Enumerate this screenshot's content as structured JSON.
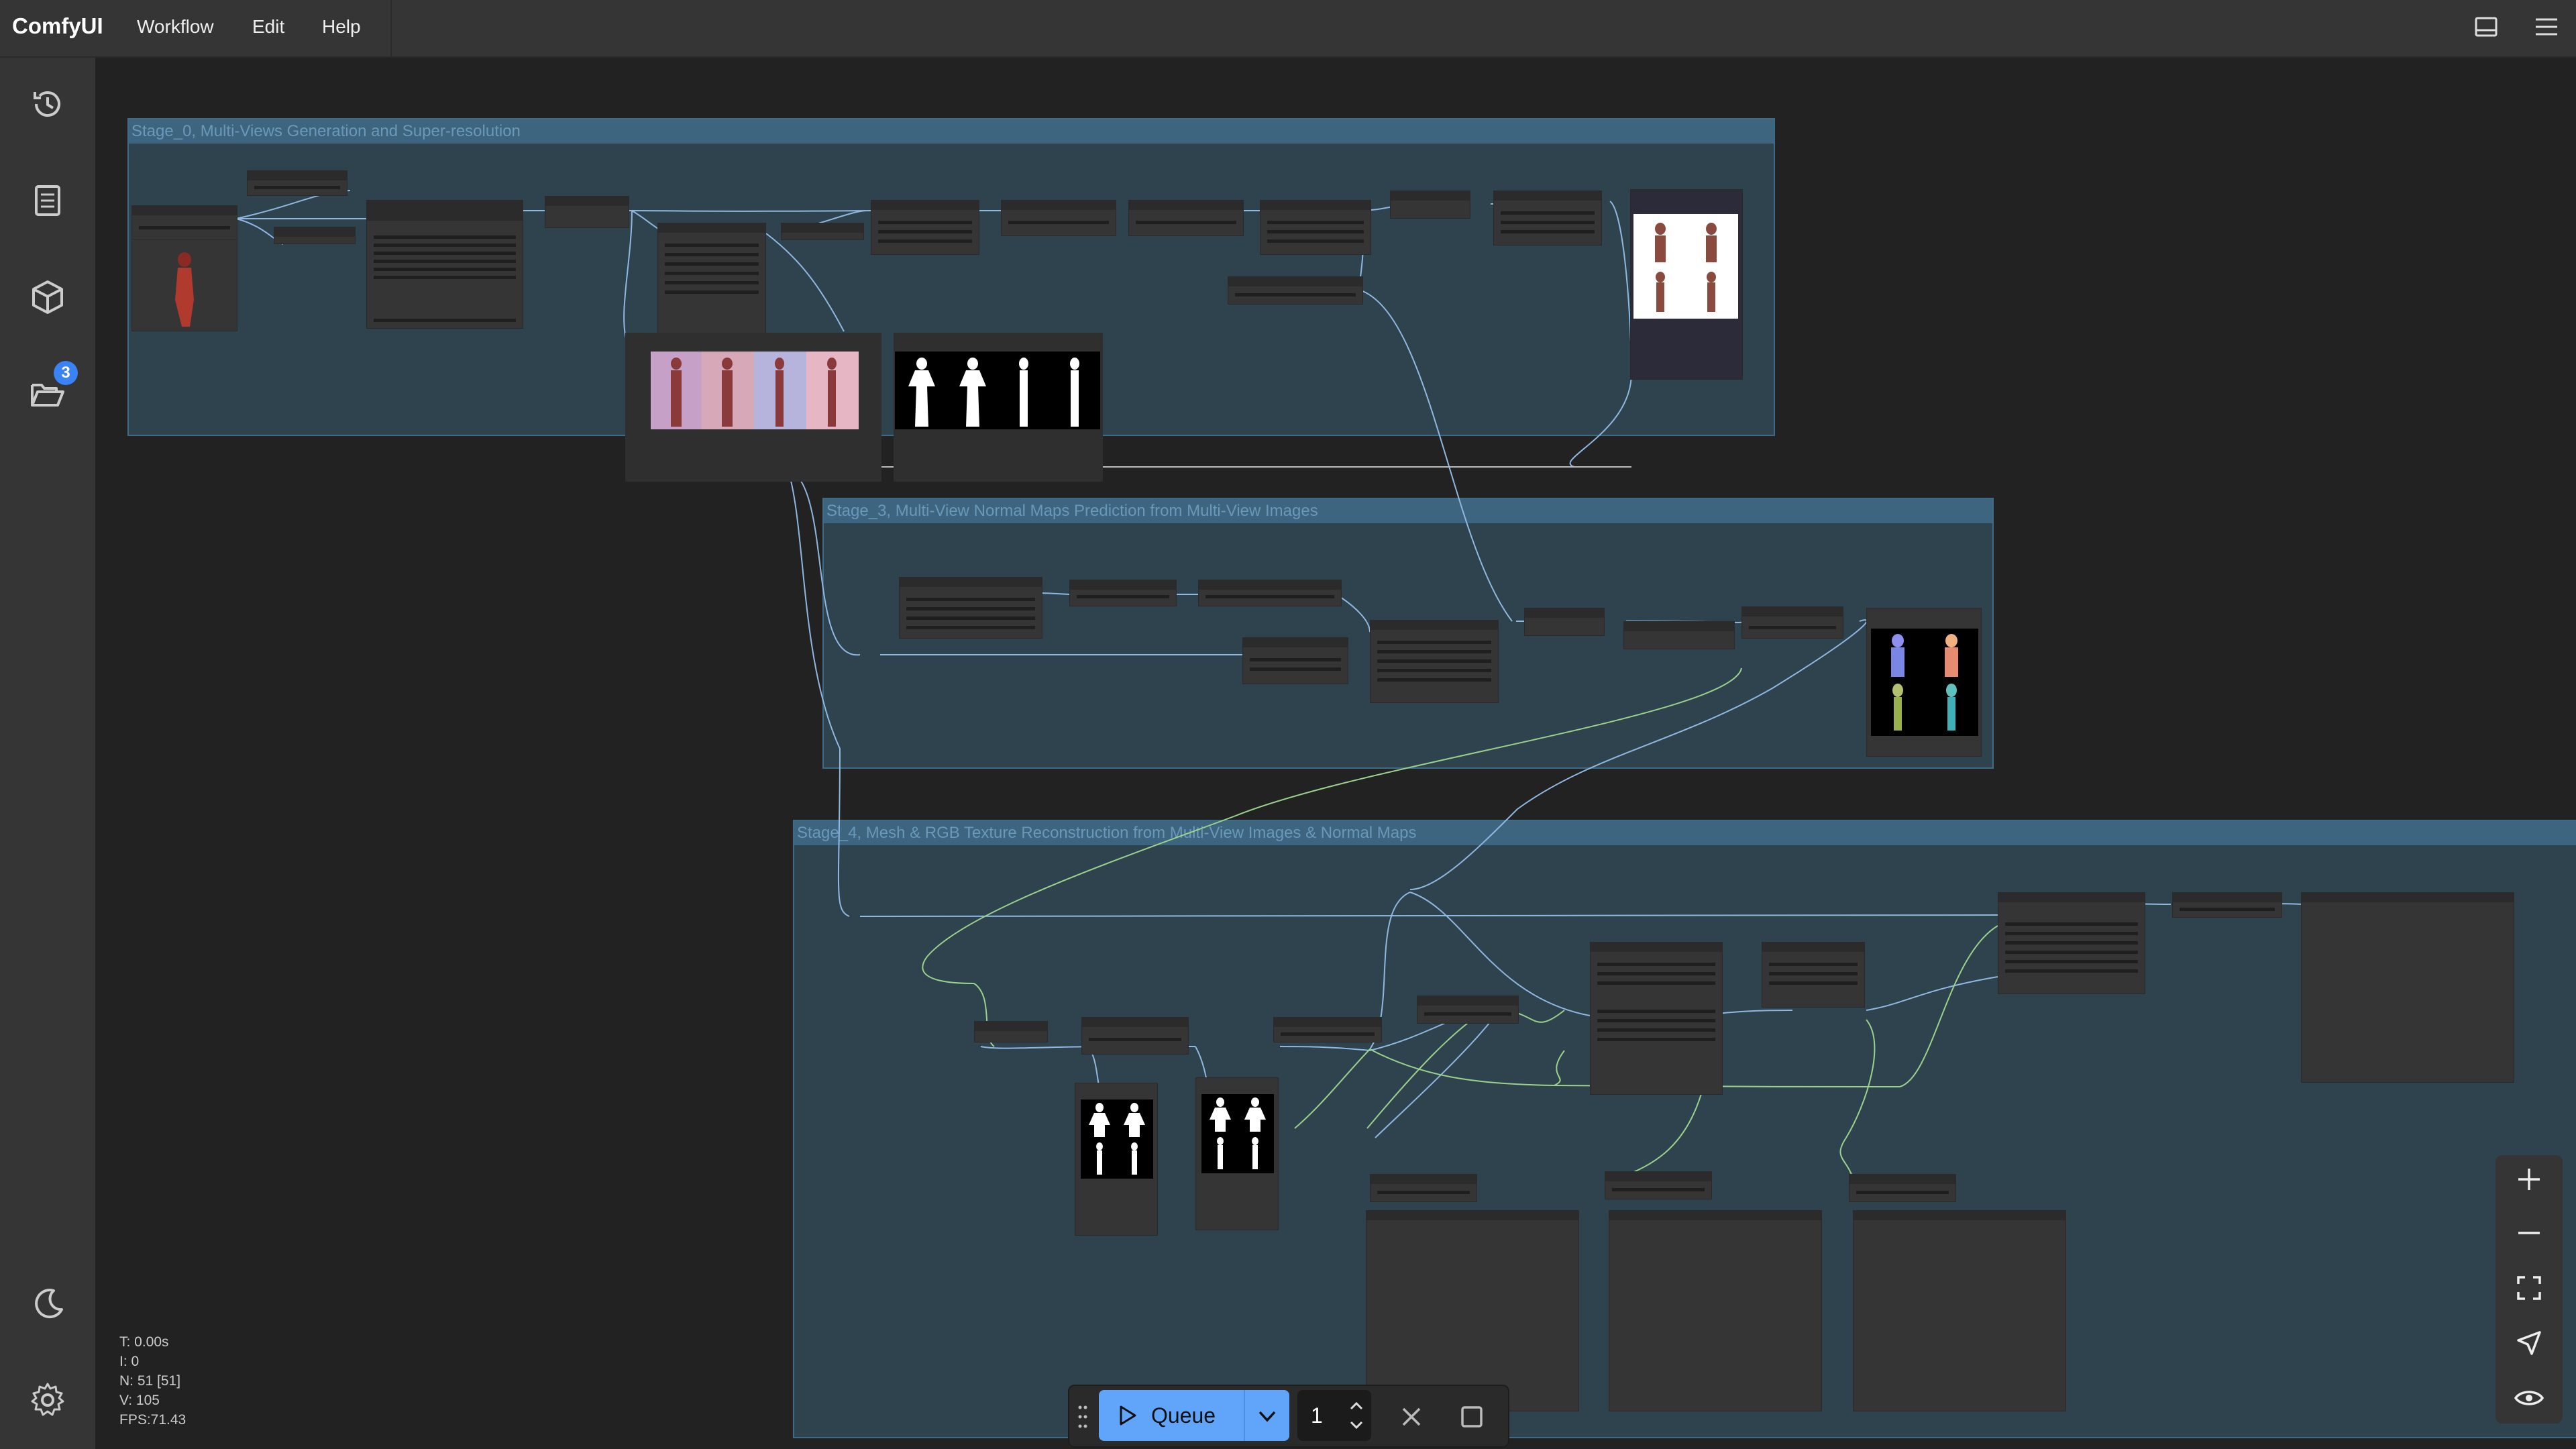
{
  "app": {
    "title": "ComfyUI"
  },
  "menu": {
    "items": [
      "Workflow",
      "Edit",
      "Help"
    ]
  },
  "topbar": {
    "icons": [
      "panel-toggle-icon",
      "hamburger-menu-icon"
    ]
  },
  "sidebar": {
    "items": [
      {
        "icon": "history-icon"
      },
      {
        "icon": "node-library-icon"
      },
      {
        "icon": "model-library-icon"
      },
      {
        "icon": "workflows-folder-icon",
        "badge": "3"
      }
    ],
    "bottom": [
      {
        "icon": "theme-moon-icon"
      },
      {
        "icon": "settings-gear-icon"
      }
    ]
  },
  "groups": [
    {
      "title": "Stage_0, Multi-Views Generation and Super-resolution"
    },
    {
      "title": "Stage_3, Multi-View Normal Maps Prediction from Multi-View Images"
    },
    {
      "title": "Stage_4, Mesh & RGB Texture Reconstruction from Multi-View Images & Normal Maps"
    }
  ],
  "stats": {
    "t": "T: 0.00s",
    "i": "I: 0",
    "n": "N: 51 [51]",
    "v": "V: 105",
    "fps": "FPS:71.43"
  },
  "queue": {
    "label": "Queue",
    "count": "1"
  },
  "colors": {
    "accent": "#60a5fa",
    "group": "#3e6580",
    "link_blue": "#8fb8e0",
    "link_green": "#9ad18b"
  }
}
